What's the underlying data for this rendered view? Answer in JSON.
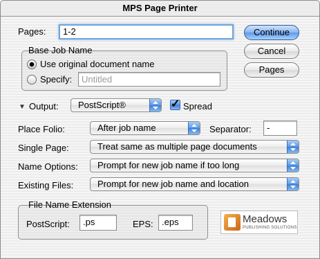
{
  "window": {
    "title": "MPS Page Printer"
  },
  "pages": {
    "label": "Pages:",
    "value": "1-2"
  },
  "buttons": {
    "continue": "Continue",
    "cancel": "Cancel",
    "pages": "Pages"
  },
  "base_job_name": {
    "title": "Base Job Name",
    "use_original_label": "Use original document name",
    "specify_label": "Specify:",
    "specify_placeholder": "Untitled",
    "selected": "use_original"
  },
  "output": {
    "label": "Output:",
    "value": "PostScript®",
    "spread_label": "Spread",
    "spread_checked": true
  },
  "place_folio": {
    "label": "Place Folio:",
    "value": "After job name",
    "separator_label": "Separator:",
    "separator_value": "-"
  },
  "single_page": {
    "label": "Single Page:",
    "value": "Treat same as multiple page documents"
  },
  "name_options": {
    "label": "Name Options:",
    "value": "Prompt for new job name if too long"
  },
  "existing_files": {
    "label": "Existing Files:",
    "value": "Prompt for new job name and location"
  },
  "file_name_extension": {
    "title": "File Name Extension",
    "postscript_label": "PostScript:",
    "postscript_value": ".ps",
    "eps_label": "EPS:",
    "eps_value": ".eps"
  },
  "logo": {
    "name": "Meadows",
    "subtitle": "PUBLISHING SOLUTIONS"
  },
  "colors": {
    "accent": "#5c98e2",
    "focus_ring": "#6fa3e0"
  }
}
